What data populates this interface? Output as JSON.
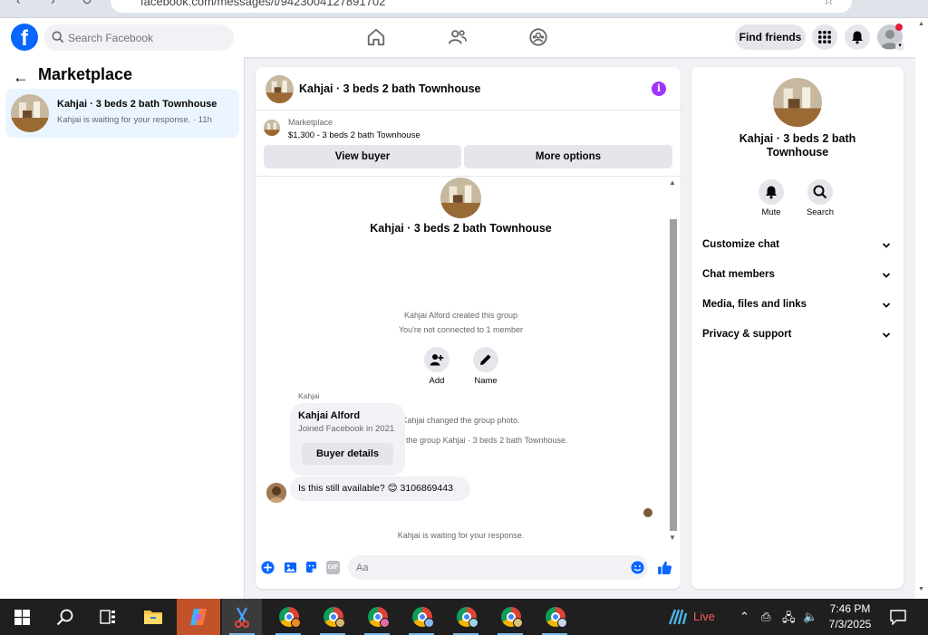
{
  "browser": {
    "url": "facebook.com/messages/t/9423004127891702"
  },
  "topnav": {
    "search_placeholder": "Search Facebook",
    "find_friends_label": "Find friends"
  },
  "sidebar": {
    "title": "Marketplace",
    "conversation": {
      "title": "Kahjai · 3 beds 2 bath Townhouse",
      "subtitle": "Kahjai is waiting for your response. · 11h"
    }
  },
  "chat": {
    "header_title": "Kahjai · 3 beds 2 bath Townhouse",
    "listing": {
      "category": "Marketplace",
      "price_title": "$1,300 - 3 beds 2 bath Townhouse",
      "view_buyer_label": "View buyer",
      "more_options_label": "More options"
    },
    "group": {
      "title": "Kahjai · 3 beds 2 bath Townhouse",
      "created_by": "Kahjai Alford created this group",
      "connection_note": "You're not connected to 1 member",
      "add_label": "Add",
      "name_label": "Name"
    },
    "events": [
      "Kahjai changed the group photo.",
      "Kahjai named the group Kahjai · 3 beds 2 bath Townhouse."
    ],
    "sender_name": "Kahjai",
    "profile_card": {
      "name": "Kahjai Alford",
      "joined": "Joined Facebook in 2021",
      "button_label": "Buyer details"
    },
    "message": {
      "text": "Is this still available?",
      "emoji": "😊",
      "phone": "3106869443"
    },
    "waiting_note": "Kahjai is waiting for your response.",
    "composer_placeholder": "Aa",
    "gif_label": "GIF"
  },
  "right_panel": {
    "title": "Kahjai · 3 beds 2 bath Townhouse",
    "mute_label": "Mute",
    "search_label": "Search",
    "sections": [
      "Customize chat",
      "Chat members",
      "Media, files and links",
      "Privacy & support"
    ]
  },
  "taskbar": {
    "live_label": "Live",
    "time": "7:46 PM",
    "date": "7/3/2025"
  },
  "colors": {
    "brand_blue": "#0866ff",
    "info_purple": "#a033ff",
    "notification_red": "#e41e3f",
    "selected_bg": "#ebf5ff"
  },
  "icons": [
    "facebook-logo-icon",
    "search-icon",
    "home-icon",
    "friends-icon",
    "groups-icon",
    "menu-grid-icon",
    "bell-icon",
    "info-icon",
    "add-person-icon",
    "pencil-icon",
    "plus-icon",
    "photo-icon",
    "sticker-icon",
    "gif-icon",
    "emoji-icon",
    "thumbs-up-icon",
    "chevron-down-icon",
    "windows-start-icon"
  ]
}
